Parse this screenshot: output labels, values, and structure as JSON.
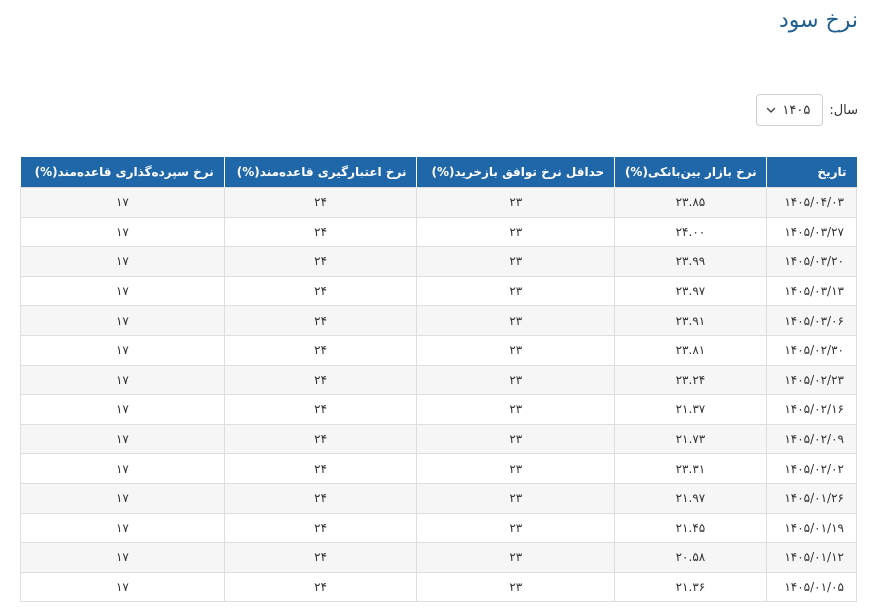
{
  "page": {
    "title": "نرخ سود"
  },
  "filter": {
    "label": "سال:",
    "selected_year": "۱۴۰۵"
  },
  "table": {
    "headers": [
      "تاریخ",
      "نرخ بازار بین‌بانکی(%)",
      "حداقل نرخ توافق بازخرید(%)",
      "نرخ اعتبارگیری قاعده‌مند(%)",
      "نرخ سپرده‌گذاری قاعده‌مند(%)"
    ],
    "rows": [
      [
        "۱۴۰۵/۰۴/۰۳",
        "۲۳.۸۵",
        "۲۳",
        "۲۴",
        "۱۷"
      ],
      [
        "۱۴۰۵/۰۳/۲۷",
        "۲۴.۰۰",
        "۲۳",
        "۲۴",
        "۱۷"
      ],
      [
        "۱۴۰۵/۰۳/۲۰",
        "۲۳.۹۹",
        "۲۳",
        "۲۴",
        "۱۷"
      ],
      [
        "۱۴۰۵/۰۳/۱۳",
        "۲۳.۹۷",
        "۲۳",
        "۲۴",
        "۱۷"
      ],
      [
        "۱۴۰۵/۰۳/۰۶",
        "۲۳.۹۱",
        "۲۳",
        "۲۴",
        "۱۷"
      ],
      [
        "۱۴۰۵/۰۲/۳۰",
        "۲۳.۸۱",
        "۲۳",
        "۲۴",
        "۱۷"
      ],
      [
        "۱۴۰۵/۰۲/۲۳",
        "۲۳.۲۴",
        "۲۳",
        "۲۴",
        "۱۷"
      ],
      [
        "۱۴۰۵/۰۲/۱۶",
        "۲۱.۳۷",
        "۲۳",
        "۲۴",
        "۱۷"
      ],
      [
        "۱۴۰۵/۰۲/۰۹",
        "۲۱.۷۳",
        "۲۳",
        "۲۴",
        "۱۷"
      ],
      [
        "۱۴۰۵/۰۲/۰۲",
        "۲۳.۳۱",
        "۲۳",
        "۲۴",
        "۱۷"
      ],
      [
        "۱۴۰۵/۰۱/۲۶",
        "۲۱.۹۷",
        "۲۳",
        "۲۴",
        "۱۷"
      ],
      [
        "۱۴۰۵/۰۱/۱۹",
        "۲۱.۴۵",
        "۲۳",
        "۲۴",
        "۱۷"
      ],
      [
        "۱۴۰۵/۰۱/۱۲",
        "۲۰.۵۸",
        "۲۳",
        "۲۴",
        "۱۷"
      ],
      [
        "۱۴۰۵/۰۱/۰۵",
        "۲۱.۳۶",
        "۲۳",
        "۲۴",
        "۱۷"
      ]
    ]
  },
  "colors": {
    "title": "#1f5f8f",
    "header_bg": "#1f67a8",
    "header_text": "#ffffff",
    "row_stripe": "#f6f6f6",
    "border": "#dedede"
  },
  "icons": {
    "year_dropdown": "chevron-down-icon"
  }
}
